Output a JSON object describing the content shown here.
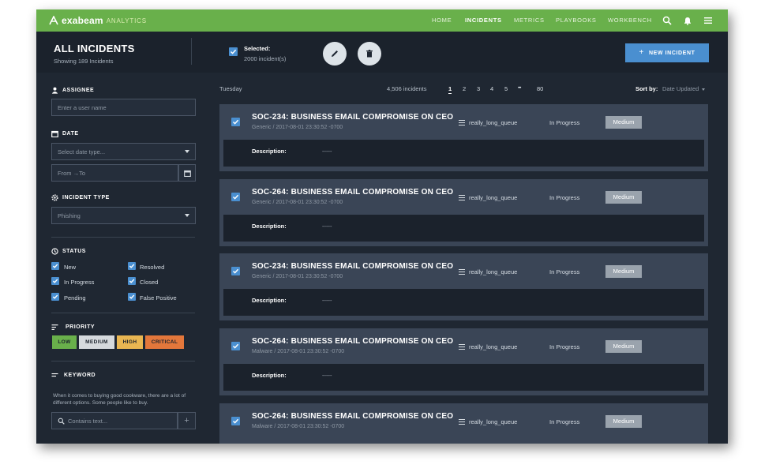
{
  "app": {
    "logo_name": "exabeam",
    "logo_sub": "ANALYTICS"
  },
  "nav": {
    "items": [
      "HOME",
      "INCIDENTS",
      "METRICS",
      "PLAYBOOKS",
      "WORKBENCH"
    ],
    "active": "INCIDENTS"
  },
  "icons": {
    "search": "search-icon",
    "bell": "bell-icon",
    "menu": "menu-icon",
    "edit": "pencil-icon",
    "delete": "trash-icon"
  },
  "header": {
    "title": "ALL INCIDENTS",
    "subtitle": "Showing 189 Incidents",
    "selected_label": "Selected:",
    "selected_count": "2000 incident(s)",
    "new_button": "NEW INCIDENT",
    "new_button_icon": "+"
  },
  "filters": {
    "assignee": {
      "label": "ASSIGNEE",
      "placeholder": "Enter a user name"
    },
    "date": {
      "label": "DATE",
      "type_placeholder": "Select date type...",
      "range_text": "From   →To"
    },
    "incident_type": {
      "label": "INCIDENT TYPE",
      "value": "Phishing"
    },
    "status": {
      "label": "STATUS",
      "options": [
        "New",
        "Resolved",
        "In Progress",
        "Closed",
        "Pending",
        "False Positive"
      ]
    },
    "priority": {
      "label": "PRIORITY",
      "levels": [
        {
          "label": "LOW",
          "color": "#69b04b"
        },
        {
          "label": "MEDIUM",
          "color": "#d5d9dd"
        },
        {
          "label": "HIGH",
          "color": "#e9b652"
        },
        {
          "label": "CRITICAL",
          "color": "#e3773b"
        }
      ]
    },
    "keyword": {
      "label": "KEYWORD",
      "help": "When it comes to buying good cookware, there are a lot of different options. Some people like to buy.",
      "placeholder": "Contains text...",
      "add_symbol": "+"
    }
  },
  "list": {
    "day": "Tuesday",
    "count": "4,506 incidents",
    "pages": [
      "1",
      "2",
      "3",
      "4",
      "5",
      "•••",
      "80"
    ],
    "active_page": "1",
    "sort_label": "Sort by:",
    "sort_value": "Date Updated"
  },
  "incidents": [
    {
      "id_title": "SOC-234: BUSINESS EMAIL COMPROMISE ON CEO",
      "meta": "Generic / 2017-08-01 23:30:52 -0700",
      "queue": "really_long_queue",
      "status": "In Progress",
      "priority": "Medium",
      "description_label": "Description:",
      "description": "-----"
    },
    {
      "id_title": "SOC-264: BUSINESS EMAIL COMPROMISE ON CEO",
      "meta": "Generic / 2017-08-01 23:30:52 -0700",
      "queue": "really_long_queue",
      "status": "In Progress",
      "priority": "Medium",
      "description_label": "Description:",
      "description": "-----"
    },
    {
      "id_title": "SOC-234: BUSINESS EMAIL COMPROMISE ON CEO",
      "meta": "Generic / 2017-08-01 23:30:52 -0700",
      "queue": "really_long_queue",
      "status": "In Progress",
      "priority": "Medium",
      "description_label": "Description:",
      "description": "-----"
    },
    {
      "id_title": "SOC-264: BUSINESS EMAIL COMPROMISE ON CEO",
      "meta": "Malware / 2017-08-01 23:30:52 -0700",
      "queue": "really_long_queue",
      "status": "In Progress",
      "priority": "Medium",
      "description_label": "Description:",
      "description": "-----"
    },
    {
      "id_title": "SOC-264: BUSINESS EMAIL COMPROMISE ON CEO",
      "meta": "Malware / 2017-08-01 23:30:52 -0700",
      "queue": "really_long_queue",
      "status": "In Progress",
      "priority": "Medium",
      "description_label": "Description:",
      "description": "-----"
    }
  ]
}
